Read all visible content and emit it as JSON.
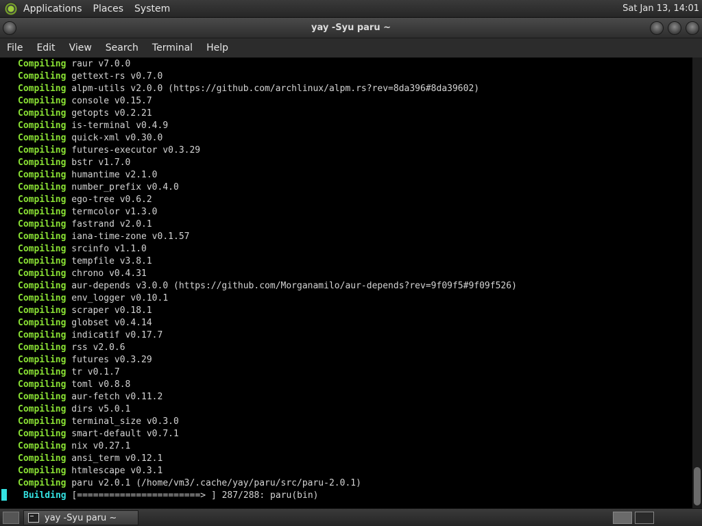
{
  "top_panel": {
    "menus": [
      "Applications",
      "Places",
      "System"
    ],
    "clock": "Sat Jan 13, 14:01"
  },
  "window": {
    "title": "yay -Syu paru ~",
    "menu": [
      "File",
      "Edit",
      "View",
      "Search",
      "Terminal",
      "Help"
    ]
  },
  "terminal": {
    "lines": [
      {
        "kw": "Compiling",
        "text": " raur v7.0.0"
      },
      {
        "kw": "Compiling",
        "text": " gettext-rs v0.7.0"
      },
      {
        "kw": "Compiling",
        "text": " alpm-utils v2.0.0 (https://github.com/archlinux/alpm.rs?rev=8da396#8da39602)"
      },
      {
        "kw": "Compiling",
        "text": " console v0.15.7"
      },
      {
        "kw": "Compiling",
        "text": " getopts v0.2.21"
      },
      {
        "kw": "Compiling",
        "text": " is-terminal v0.4.9"
      },
      {
        "kw": "Compiling",
        "text": " quick-xml v0.30.0"
      },
      {
        "kw": "Compiling",
        "text": " futures-executor v0.3.29"
      },
      {
        "kw": "Compiling",
        "text": " bstr v1.7.0"
      },
      {
        "kw": "Compiling",
        "text": " humantime v2.1.0"
      },
      {
        "kw": "Compiling",
        "text": " number_prefix v0.4.0"
      },
      {
        "kw": "Compiling",
        "text": " ego-tree v0.6.2"
      },
      {
        "kw": "Compiling",
        "text": " termcolor v1.3.0"
      },
      {
        "kw": "Compiling",
        "text": " fastrand v2.0.1"
      },
      {
        "kw": "Compiling",
        "text": " iana-time-zone v0.1.57"
      },
      {
        "kw": "Compiling",
        "text": " srcinfo v1.1.0"
      },
      {
        "kw": "Compiling",
        "text": " tempfile v3.8.1"
      },
      {
        "kw": "Compiling",
        "text": " chrono v0.4.31"
      },
      {
        "kw": "Compiling",
        "text": " aur-depends v3.0.0 (https://github.com/Morganamilo/aur-depends?rev=9f09f5#9f09f526)"
      },
      {
        "kw": "Compiling",
        "text": " env_logger v0.10.1"
      },
      {
        "kw": "Compiling",
        "text": " scraper v0.18.1"
      },
      {
        "kw": "Compiling",
        "text": " globset v0.4.14"
      },
      {
        "kw": "Compiling",
        "text": " indicatif v0.17.7"
      },
      {
        "kw": "Compiling",
        "text": " rss v2.0.6"
      },
      {
        "kw": "Compiling",
        "text": " futures v0.3.29"
      },
      {
        "kw": "Compiling",
        "text": " tr v0.1.7"
      },
      {
        "kw": "Compiling",
        "text": " toml v0.8.8"
      },
      {
        "kw": "Compiling",
        "text": " aur-fetch v0.11.2"
      },
      {
        "kw": "Compiling",
        "text": " dirs v5.0.1"
      },
      {
        "kw": "Compiling",
        "text": " terminal_size v0.3.0"
      },
      {
        "kw": "Compiling",
        "text": " smart-default v0.7.1"
      },
      {
        "kw": "Compiling",
        "text": " nix v0.27.1"
      },
      {
        "kw": "Compiling",
        "text": " ansi_term v0.12.1"
      },
      {
        "kw": "Compiling",
        "text": " htmlescape v0.3.1"
      },
      {
        "kw": "Compiling",
        "text": " paru v2.0.1 (/home/vm3/.cache/yay/paru/src/paru-2.0.1)"
      }
    ],
    "building": {
      "kw": "Building",
      "text": " [=======================> ] 287/288: paru(bin)"
    }
  },
  "colors": {
    "compiling": "#8ae234",
    "building": "#34e2e2",
    "background": "#000000"
  }
}
